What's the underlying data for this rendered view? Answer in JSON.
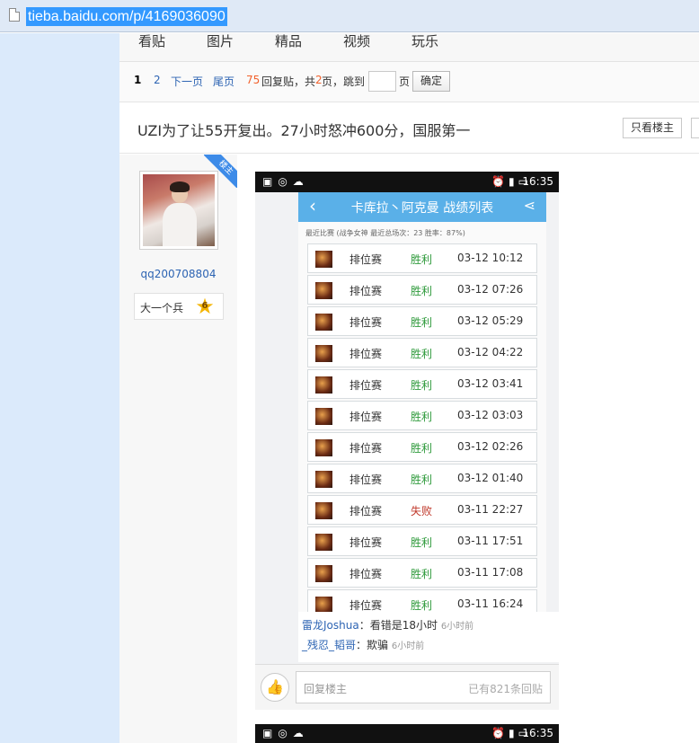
{
  "browser": {
    "url": "tieba.baidu.com/p/4169036090"
  },
  "nav": {
    "tabs": [
      "看贴",
      "图片",
      "精品",
      "视频",
      "玩乐"
    ]
  },
  "pager": {
    "current_page": "1",
    "page_2": "2",
    "next": "下一页",
    "last": "尾页",
    "reply_count": "75",
    "reply_label": "回复贴，共",
    "total_pages": "2",
    "pages_label": "页，跳到",
    "page_unit": "页",
    "confirm": "确定"
  },
  "thread": {
    "title": "UZI为了让55开复出。27小时怒冲600分，国服第一",
    "only_op_button": "只看楼主"
  },
  "author": {
    "badge": "楼主",
    "username": "qq200708804",
    "rank_title": "大一个兵",
    "level": "6"
  },
  "screenshot": {
    "status_time": "16:35",
    "app_title": "卡库拉丶阿克曼 战绩列表",
    "stats_line": "最近比赛 (战争女神 最近总场次：23 胜率：87%)",
    "matches": [
      {
        "mode": "排位赛",
        "result": "胜利",
        "time": "03-12 10:12"
      },
      {
        "mode": "排位赛",
        "result": "胜利",
        "time": "03-12 07:26"
      },
      {
        "mode": "排位赛",
        "result": "胜利",
        "time": "03-12 05:29"
      },
      {
        "mode": "排位赛",
        "result": "胜利",
        "time": "03-12 04:22"
      },
      {
        "mode": "排位赛",
        "result": "胜利",
        "time": "03-12 03:41"
      },
      {
        "mode": "排位赛",
        "result": "胜利",
        "time": "03-12 03:03"
      },
      {
        "mode": "排位赛",
        "result": "胜利",
        "time": "03-12 02:26"
      },
      {
        "mode": "排位赛",
        "result": "胜利",
        "time": "03-12 01:40"
      },
      {
        "mode": "排位赛",
        "result": "失败",
        "time": "03-11 22:27"
      },
      {
        "mode": "排位赛",
        "result": "胜利",
        "time": "03-11 17:51"
      },
      {
        "mode": "排位赛",
        "result": "胜利",
        "time": "03-11 17:08"
      },
      {
        "mode": "排位赛",
        "result": "胜利",
        "time": "03-11 16:24"
      }
    ],
    "comments": [
      {
        "user": "雷龙Joshua",
        "text": "：看错是18小时",
        "ago": "6小时前"
      },
      {
        "user": "_残忍_韬哥",
        "text": "：欺骗",
        "ago": "6小时前"
      }
    ],
    "reply_placeholder": "回复楼主",
    "reply_count_text": "已有821条回贴"
  },
  "screenshot2": {
    "status_time": "16:35"
  },
  "colors": {
    "win": "#2e9a3b",
    "lose": "#c0392b",
    "link": "#2d64b3",
    "app_bar": "#5ab0e8"
  }
}
